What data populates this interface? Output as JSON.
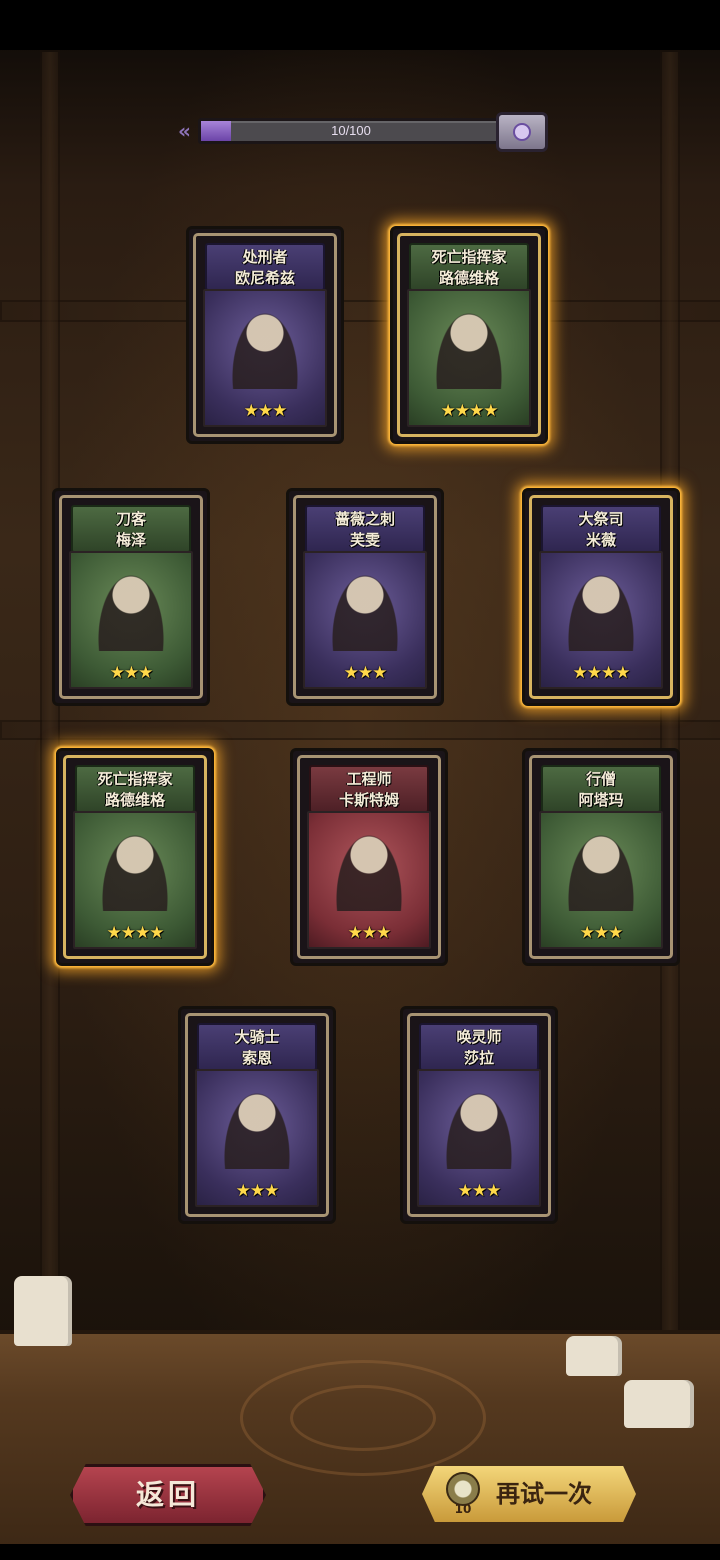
{
  "progress": {
    "text": "10/100",
    "fraction": 0.1
  },
  "cards": [
    {
      "line1": "处刑者",
      "line2": "欧尼希兹",
      "stars": "★★★",
      "bg": "purple",
      "gold": false
    },
    {
      "line1": "死亡指挥家",
      "line2": "路德维格",
      "stars": "★★★★",
      "bg": "green",
      "gold": true
    },
    {
      "line1": "刀客",
      "line2": "梅泽",
      "stars": "★★★",
      "bg": "green",
      "gold": false
    },
    {
      "line1": "蔷薇之刺",
      "line2": "芙雯",
      "stars": "★★★",
      "bg": "purple",
      "gold": false
    },
    {
      "line1": "大祭司",
      "line2": "米薇",
      "stars": "★★★★",
      "bg": "purple",
      "gold": true
    },
    {
      "line1": "死亡指挥家",
      "line2": "路德维格",
      "stars": "★★★★",
      "bg": "green",
      "gold": true
    },
    {
      "line1": "工程师",
      "line2": "卡斯特姆",
      "stars": "★★★",
      "bg": "red",
      "gold": false
    },
    {
      "line1": "行僧",
      "line2": "阿塔玛",
      "stars": "★★★",
      "bg": "green",
      "gold": false
    },
    {
      "line1": "大骑士",
      "line2": "索恩",
      "stars": "★★★",
      "bg": "purple",
      "gold": false
    },
    {
      "line1": "唤灵师",
      "line2": "莎拉",
      "stars": "★★★",
      "bg": "purple",
      "gold": false
    }
  ],
  "buttons": {
    "back_label": "返回",
    "retry_label": "再试一次",
    "retry_cost": "10"
  }
}
